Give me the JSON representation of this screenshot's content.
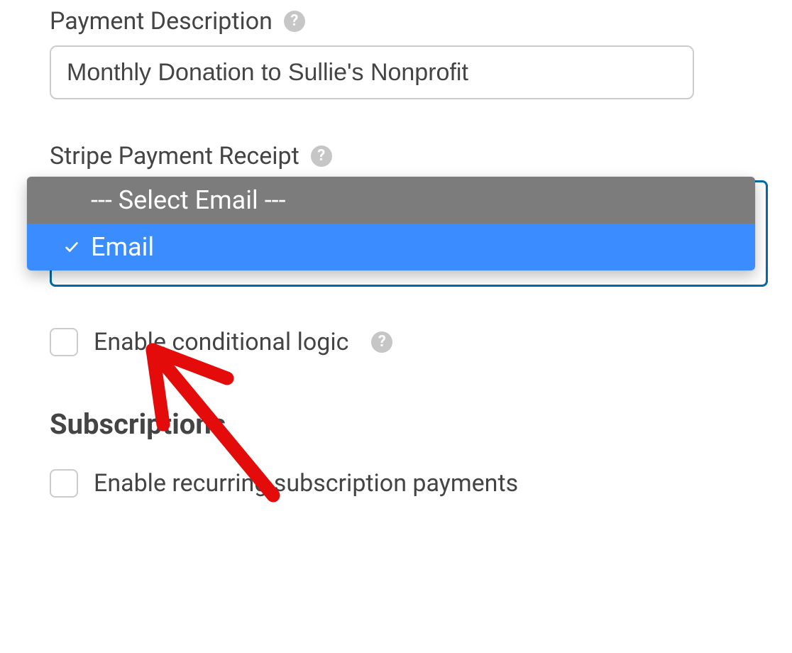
{
  "payment_description": {
    "label": "Payment Description",
    "value": "Monthly Donation to Sullie's Nonprofit",
    "help_glyph": "?"
  },
  "stripe_receipt": {
    "label": "Stripe Payment Receipt",
    "help_glyph": "?",
    "dropdown": {
      "placeholder": "--- Select Email ---",
      "options": [
        {
          "label": "Email",
          "selected": true
        }
      ]
    }
  },
  "conditional_logic": {
    "label": "Enable conditional logic",
    "checked": false,
    "help_glyph": "?"
  },
  "subscriptions": {
    "heading": "Subscriptions",
    "recurring": {
      "label": "Enable recurring subscription payments",
      "checked": false
    }
  },
  "annotation": {
    "color": "#e40b0b"
  }
}
